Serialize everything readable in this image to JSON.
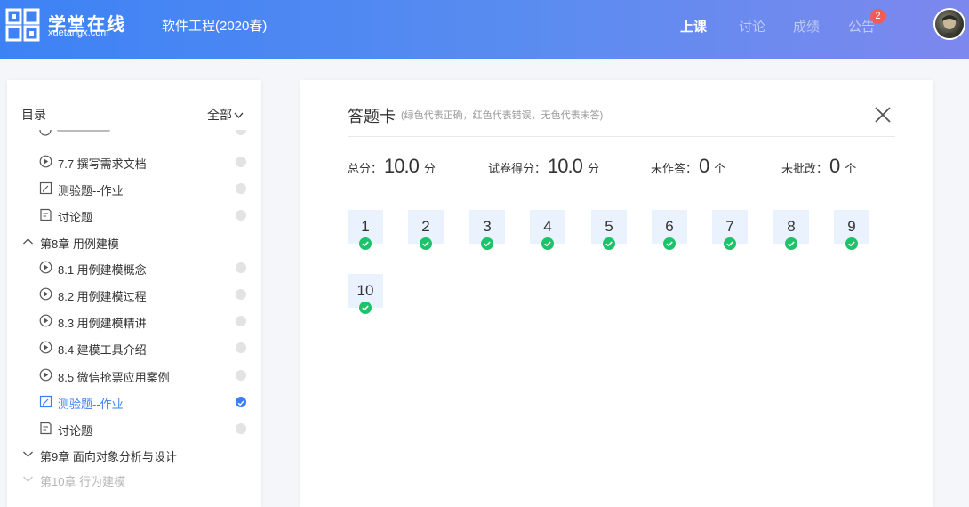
{
  "header": {
    "brand_title": "学堂在线",
    "brand_sub": "xuetangx.com",
    "course_title": "软件工程(2020春)",
    "nav": [
      {
        "label": "上课",
        "active": true
      },
      {
        "label": "讨论",
        "active": false
      },
      {
        "label": "成绩",
        "active": false
      },
      {
        "label": "公告",
        "active": false
      }
    ],
    "notice_badge": "2"
  },
  "sidebar": {
    "title": "目录",
    "filter_label": "全部",
    "items": [
      {
        "label": "7.7 撰写需求文档",
        "icon": "play-circle-icon",
        "type": "lesson"
      },
      {
        "label": "测验题--作业",
        "icon": "quiz-icon",
        "type": "lesson"
      },
      {
        "label": "讨论题",
        "icon": "discussion-icon",
        "type": "lesson"
      },
      {
        "label": "第8章 用例建模",
        "icon": "chevron-up-icon",
        "type": "chapter"
      },
      {
        "label": "8.1 用例建模概念",
        "icon": "play-circle-icon",
        "type": "lesson"
      },
      {
        "label": "8.2 用例建模过程",
        "icon": "play-circle-icon",
        "type": "lesson"
      },
      {
        "label": "8.3 用例建模精讲",
        "icon": "play-circle-icon",
        "type": "lesson"
      },
      {
        "label": "8.4 建模工具介绍",
        "icon": "play-circle-icon",
        "type": "lesson"
      },
      {
        "label": "8.5 微信抢票应用案例",
        "icon": "play-circle-icon",
        "type": "lesson"
      },
      {
        "label": "测验题--作业",
        "icon": "quiz-icon",
        "type": "lesson",
        "current": true
      },
      {
        "label": "讨论题",
        "icon": "discussion-icon",
        "type": "lesson"
      },
      {
        "label": "第9章 面向对象分析与设计",
        "icon": "chevron-down-icon",
        "type": "chapter"
      },
      {
        "label": "第10章 行为建模",
        "icon": "chevron-down-icon",
        "type": "chapter",
        "faded": true
      }
    ]
  },
  "answer_card": {
    "title": "答题卡",
    "hint": "(绿色代表正确，红色代表错误，无色代表未答)",
    "stats": {
      "total_label": "总分：",
      "total_value": "10.0",
      "total_unit": "分",
      "score_label": "试卷得分：",
      "score_value": "10.0",
      "score_unit": "分",
      "unanswered_label": "未作答：",
      "unanswered_value": "0",
      "unanswered_unit": "个",
      "ungraded_label": "未批改：",
      "ungraded_value": "0",
      "ungraded_unit": "个"
    },
    "questions": [
      "1",
      "2",
      "3",
      "4",
      "5",
      "6",
      "7",
      "8",
      "9",
      "10"
    ],
    "correct_color": "#1ec26a"
  },
  "colors": {
    "accent": "#3c7ef2",
    "header_start": "#3d82f5",
    "header_end": "#7d88ee",
    "badge": "#f25b5b"
  }
}
